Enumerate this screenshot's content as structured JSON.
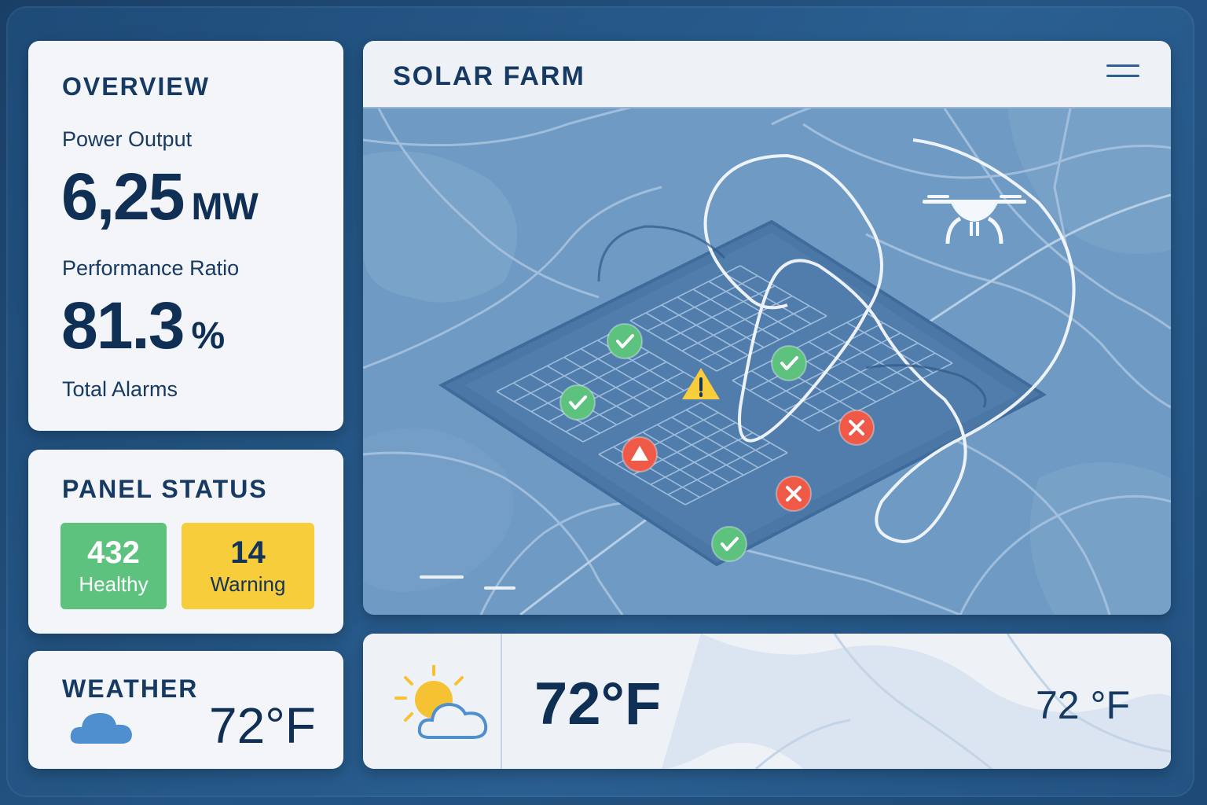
{
  "overview": {
    "title": "OVERVIEW",
    "power_output_label": "Power Output",
    "power_output_value": "6,25",
    "power_output_unit": "MW",
    "performance_ratio_label": "Performance Ratio",
    "performance_ratio_value": "81.3",
    "performance_ratio_unit": "%",
    "total_alarms_label": "Total Alarms"
  },
  "panel_status": {
    "title": "PANEL STATUS",
    "healthy_count": "432",
    "healthy_label": "Healthy",
    "warning_count": "14",
    "warning_label": "Warning"
  },
  "weather": {
    "title": "WEATHER",
    "temperature": "72°F",
    "icon": "cloud-icon"
  },
  "map": {
    "title": "SOLAR FARM",
    "menu_icon": "hamburger-menu-icon",
    "drone_icon": "drone-icon",
    "markers": [
      {
        "status": "ok",
        "icon": "check-icon"
      },
      {
        "status": "ok",
        "icon": "check-icon"
      },
      {
        "status": "ok",
        "icon": "check-icon"
      },
      {
        "status": "ok",
        "icon": "check-icon"
      },
      {
        "status": "warning",
        "icon": "warning-icon"
      },
      {
        "status": "alert",
        "icon": "alert-triangle-icon"
      },
      {
        "status": "error",
        "icon": "x-icon"
      },
      {
        "status": "error",
        "icon": "x-icon"
      }
    ]
  },
  "weather_wide": {
    "icon": "partly-sunny-icon",
    "temperature_large": "72°F",
    "temperature_small": "72 °F"
  },
  "colors": {
    "background": "#1e4b78",
    "card": "#f3f5f8",
    "text": "#0f2f55",
    "healthy": "#5dc27e",
    "warning": "#f7cd3c",
    "error": "#ee5a47",
    "map": "#6e9ac4"
  }
}
